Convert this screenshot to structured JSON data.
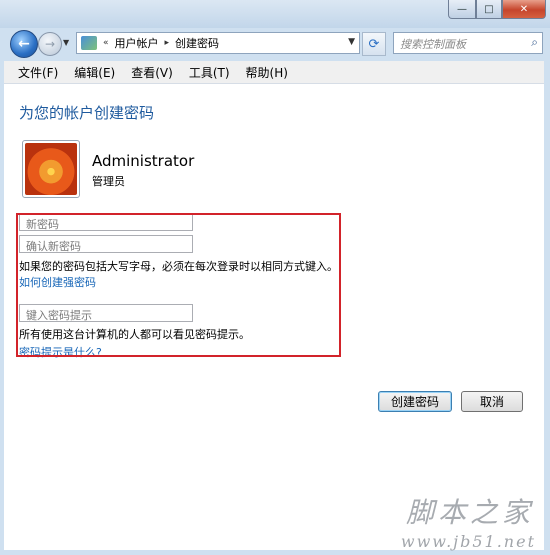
{
  "window": {
    "minimize_glyph": "—",
    "maximize_glyph": "□",
    "close_glyph": "✕"
  },
  "nav": {
    "breadcrumb": [
      "用户帐户",
      "创建密码"
    ],
    "breadcrumb_prefix": "«",
    "breadcrumb_separator": "▸",
    "search_placeholder": "搜索控制面板"
  },
  "menu": [
    "文件(F)",
    "编辑(E)",
    "查看(V)",
    "工具(T)",
    "帮助(H)"
  ],
  "page": {
    "heading": "为您的帐户创建密码",
    "user_name": "Administrator",
    "user_role": "管理员"
  },
  "form": {
    "new_password_placeholder": "新密码",
    "confirm_password_placeholder": "确认新密码",
    "case_note": "如果您的密码包括大写字母，必须在每次登录时以相同方式键入。",
    "strong_password_link": "如何创建强密码",
    "hint_placeholder": "键入密码提示",
    "hint_note": "所有使用这台计算机的人都可以看见密码提示。",
    "hint_link": "密码提示是什么?"
  },
  "buttons": {
    "create": "创建密码",
    "cancel": "取消"
  },
  "watermark": {
    "site_name": "脚本之家",
    "url": "www.jb51.net"
  },
  "colors": {
    "heading": "#1e5a9e",
    "link": "#1665b7",
    "highlight_box": "#d2232a"
  }
}
